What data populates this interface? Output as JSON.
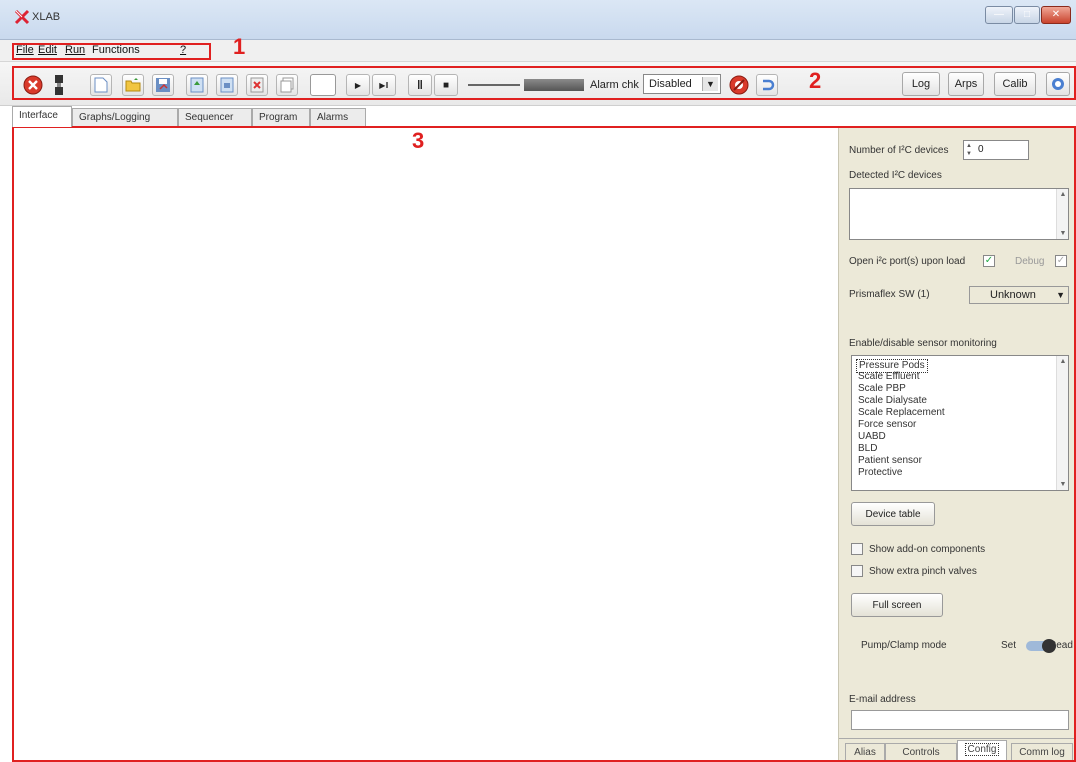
{
  "window": {
    "title": "XLAB",
    "controls": {
      "minimize_glyph": "—",
      "maximize_glyph": "□",
      "close_glyph": "✕"
    }
  },
  "menu": {
    "items": [
      "File",
      "Edit",
      "Run",
      "Functions",
      "?"
    ],
    "callout": "1"
  },
  "toolbar": {
    "callout": "2",
    "icons": [
      "stop-icon",
      "connect-icon",
      "new-file-icon",
      "open-file-icon",
      "save-icon",
      "export-icon",
      "import-icon",
      "delete-icon",
      "copy-icon"
    ],
    "play_glyph": "▶",
    "step_glyph": "▶‖",
    "pause_glyph": "‖",
    "stop_glyph": "■",
    "alarm_label": "Alarm chk",
    "alarm_value": "Disabled",
    "buttons": {
      "log": "Log",
      "arps": "Arps",
      "calib": "Calib"
    }
  },
  "tabs": {
    "items": [
      "Interface",
      "Graphs/Logging",
      "Sequencer",
      "Program",
      "Alarms"
    ],
    "active": "Interface",
    "callout": "3"
  },
  "panel": {
    "num_devices_label": "Number of I²C devices",
    "num_devices_value": "0",
    "detected_label": "Detected I²C devices",
    "open_port_label": "Open i²c port(s) upon load",
    "debug_label": "Debug",
    "prismaflex_label": "Prismaflex SW (1)",
    "prismaflex_value": "Unknown",
    "monitoring_label": "Enable/disable sensor monitoring",
    "sensors": [
      "Pressure Pods",
      "Scale Effluent",
      "Scale PBP",
      "Scale Dialysate",
      "Scale Replacement",
      "Force sensor",
      "UABD",
      "BLD",
      "Patient sensor",
      "Protective"
    ],
    "device_table_label": "Device table",
    "show_addon_label": "Show add-on components",
    "show_pinch_label": "Show extra pinch valves",
    "fullscreen_label": "Full screen",
    "pump_mode_label": "Pump/Clamp mode",
    "set_label": "Set",
    "read_label": "Read",
    "email_label": "E-mail address",
    "email_value": "",
    "bottom_tabs": [
      "Alias",
      "Controls",
      "Config",
      "Comm log"
    ],
    "active_bottom_tab": "Config"
  },
  "colors": {
    "callout": "#e02020",
    "panel_bg": "#ece9d8",
    "titlebar": "#c9d9ee"
  }
}
